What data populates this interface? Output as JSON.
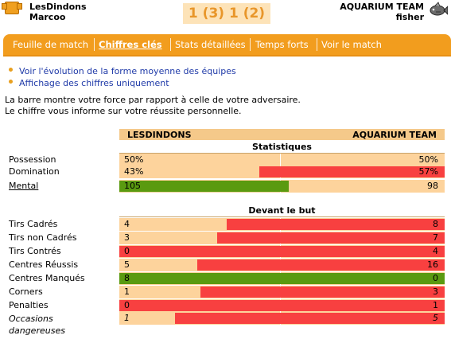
{
  "header": {
    "home_team": "LesDindons",
    "home_manager": "Marcoo",
    "score": "1 (3) 1 (2)",
    "away_team": "AQUARIUM TEAM",
    "away_manager": "fisher"
  },
  "tabs": [
    {
      "label": "Feuille de match",
      "active": false
    },
    {
      "label": "Chiffres clés",
      "active": true
    },
    {
      "label": "Stats détaillées",
      "active": false
    },
    {
      "label": "Temps forts",
      "active": false
    },
    {
      "label": "Voir le match",
      "active": false
    }
  ],
  "links": [
    "Voir l'évolution de la forme moyenne des équipes",
    "Affichage des chiffres uniquement"
  ],
  "info": [
    "La barre montre votre force par rapport à celle de votre adversaire.",
    "Le chiffre vous informe sur votre réussite personnelle."
  ],
  "columns": {
    "home": "LESDINDONS",
    "away": "AQUARIUM TEAM"
  },
  "sections": {
    "stats": "Statistiques",
    "goal": "Devant le but"
  },
  "colors": {
    "red": "#f84040",
    "green": "#5a9a10",
    "background": "#fdd39c",
    "tab": "#f29d1e"
  },
  "stats_rows": [
    {
      "label": "Possession",
      "home": "50%",
      "away": "50%",
      "home_share": 0.5,
      "bar": "none"
    },
    {
      "label": "Domination",
      "home": "43%",
      "away": "57%",
      "home_share": 0.43,
      "bar": "away"
    },
    {
      "label": "Mental",
      "home": "105",
      "away": "98",
      "home_share": 0.52,
      "bar": "home",
      "underline": true
    }
  ],
  "goal_rows": [
    {
      "label": "Tirs Cadrés",
      "home": "4",
      "away": "8",
      "home_share": 0.33,
      "bar": "away"
    },
    {
      "label": "Tirs non Cadrés",
      "home": "3",
      "away": "7",
      "home_share": 0.3,
      "bar": "away"
    },
    {
      "label": "Tirs Contrés",
      "home": "0",
      "away": "4",
      "home_share": 0.0,
      "bar": "away"
    },
    {
      "label": "Centres Réussis",
      "home": "5",
      "away": "16",
      "home_share": 0.24,
      "bar": "away"
    },
    {
      "label": "Centres Manqués",
      "home": "8",
      "away": "0",
      "home_share": 1.0,
      "bar": "home"
    },
    {
      "label": "Corners",
      "home": "1",
      "away": "3",
      "home_share": 0.25,
      "bar": "away"
    },
    {
      "label": "Penalties",
      "home": "0",
      "away": "1",
      "home_share": 0.0,
      "bar": "away"
    },
    {
      "label": "Occasions dangereuses",
      "home": "1",
      "away": "5",
      "home_share": 0.17,
      "bar": "away",
      "italic": true
    }
  ]
}
